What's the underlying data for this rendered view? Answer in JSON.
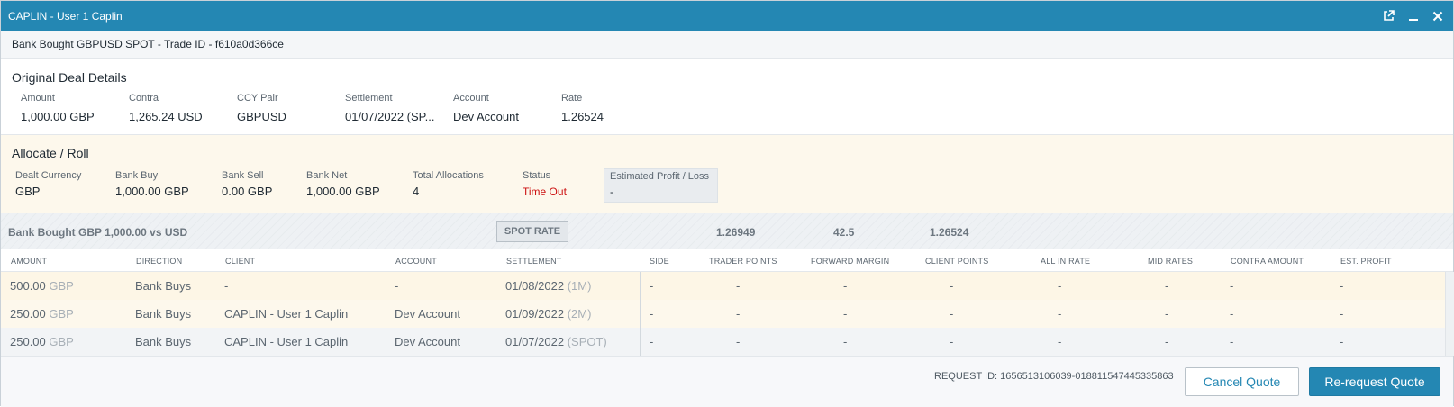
{
  "window": {
    "title": "CAPLIN - User 1 Caplin"
  },
  "trade_header": "Bank Bought GBPUSD SPOT - Trade ID - f610a0d366ce",
  "original_deal": {
    "title": "Original Deal Details",
    "fields": [
      {
        "label": "Amount",
        "value": "1,000.00 GBP"
      },
      {
        "label": "Contra",
        "value": "1,265.24 USD"
      },
      {
        "label": "CCY Pair",
        "value": "GBPUSD"
      },
      {
        "label": "Settlement",
        "value": "01/07/2022 (SP..."
      },
      {
        "label": "Account",
        "value": "Dev Account"
      },
      {
        "label": "Rate",
        "value": "1.26524"
      }
    ]
  },
  "allocate": {
    "title": "Allocate / Roll",
    "fields": [
      {
        "label": "Dealt Currency",
        "value": "GBP"
      },
      {
        "label": "Bank Buy",
        "value": "1,000.00 GBP"
      },
      {
        "label": "Bank Sell",
        "value": "0.00 GBP"
      },
      {
        "label": "Bank Net",
        "value": "1,000.00 GBP"
      },
      {
        "label": "Total Allocations",
        "value": "4"
      },
      {
        "label": "Status",
        "value": "Time Out"
      }
    ],
    "estimated": {
      "label": "Estimated Profit / Loss",
      "value": "-"
    },
    "status_color": "#cc1111"
  },
  "summary": {
    "description": "Bank Bought GBP 1,000.00 vs USD",
    "spot_rate_button": "SPOT RATE",
    "values": [
      "1.26949",
      "42.5",
      "1.26524"
    ]
  },
  "table": {
    "columns": [
      "AMOUNT",
      "DIRECTION",
      "CLIENT",
      "ACCOUNT",
      "SETTLEMENT",
      "SIDE",
      "TRADER POINTS",
      "FORWARD MARGIN",
      "CLIENT POINTS",
      "ALL IN RATE",
      "MID RATES",
      "CONTRA AMOUNT",
      "EST. PROFIT"
    ],
    "rows": [
      {
        "amount": "500.00",
        "ccy": "GBP",
        "direction": "Bank Buys",
        "client": "-",
        "account": "-",
        "settlement": "01/08/2022",
        "tenor": "(1M)",
        "side": "-",
        "trader_points": "-",
        "forward_margin": "-",
        "client_points": "-",
        "all_in_rate": "-",
        "mid_rates": "-",
        "contra_amount": "-",
        "est_profit": "-"
      },
      {
        "amount": "250.00",
        "ccy": "GBP",
        "direction": "Bank Buys",
        "client": "CAPLIN - User 1 Caplin",
        "account": "Dev Account",
        "settlement": "01/09/2022",
        "tenor": "(2M)",
        "side": "-",
        "trader_points": "-",
        "forward_margin": "-",
        "client_points": "-",
        "all_in_rate": "-",
        "mid_rates": "-",
        "contra_amount": "-",
        "est_profit": "-"
      },
      {
        "amount": "250.00",
        "ccy": "GBP",
        "direction": "Bank Buys",
        "client": "CAPLIN - User 1 Caplin",
        "account": "Dev Account",
        "settlement": "01/07/2022",
        "tenor": "(SPOT)",
        "side": "-",
        "trader_points": "-",
        "forward_margin": "-",
        "client_points": "-",
        "all_in_rate": "-",
        "mid_rates": "-",
        "contra_amount": "-",
        "est_profit": "-"
      }
    ]
  },
  "footer": {
    "request_id": "REQUEST ID: 1656513106039-018811547445335863",
    "cancel_label": "Cancel Quote",
    "requote_label": "Re-request Quote"
  },
  "colors": {
    "titlebar": "#2487b3",
    "accent": "#2487b3",
    "alloc_bg": "#fdf8ec"
  },
  "icons": [
    "popout-icon",
    "minimize-icon",
    "close-icon"
  ]
}
